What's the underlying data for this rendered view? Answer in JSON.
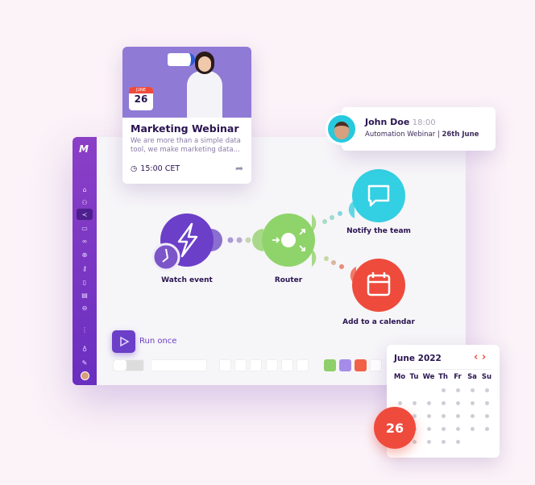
{
  "webinar_card": {
    "date_month": "JUNE",
    "date_day": "26",
    "title": "Marketing Webinar",
    "description": "We are more than a simple data tool, we make marketing data...",
    "time": "15:00 CET",
    "icons": [
      "clock-icon",
      "share-icon"
    ]
  },
  "notification": {
    "name": "John Doe",
    "time": "18:00",
    "message": "Automation Webinar | ",
    "message_bold": "26th June"
  },
  "sidebar": {
    "logo": "M",
    "items": [
      "home-icon",
      "users-icon",
      "share-nodes-icon",
      "folder-icon",
      "link-icon",
      "globe-icon",
      "key-icon",
      "mobile-icon",
      "database-icon",
      "box-icon",
      "more-icon",
      "bell-icon",
      "wrench-icon",
      "avatar"
    ],
    "active": "share-nodes-icon"
  },
  "scenario": {
    "nodes": [
      {
        "label": "Watch event",
        "color": "#6b3fc8"
      },
      {
        "label": "Router",
        "color": "#8fd46a"
      },
      {
        "label": "Notify the team",
        "color": "#33cfe2"
      },
      {
        "label": "Add to a calendar",
        "color": "#ee4b3d"
      }
    ],
    "run_once_label": "Run once",
    "toolbar_colors": [
      "#8fcf6a",
      "#a58ce8",
      "#f06148"
    ]
  },
  "calendar": {
    "month": "June 2022",
    "weekdays": [
      "Mo",
      "Tu",
      "We",
      "Th",
      "Fr",
      "Sa",
      "Su"
    ],
    "selected_day": "26",
    "accent": "#ee4b3d"
  }
}
